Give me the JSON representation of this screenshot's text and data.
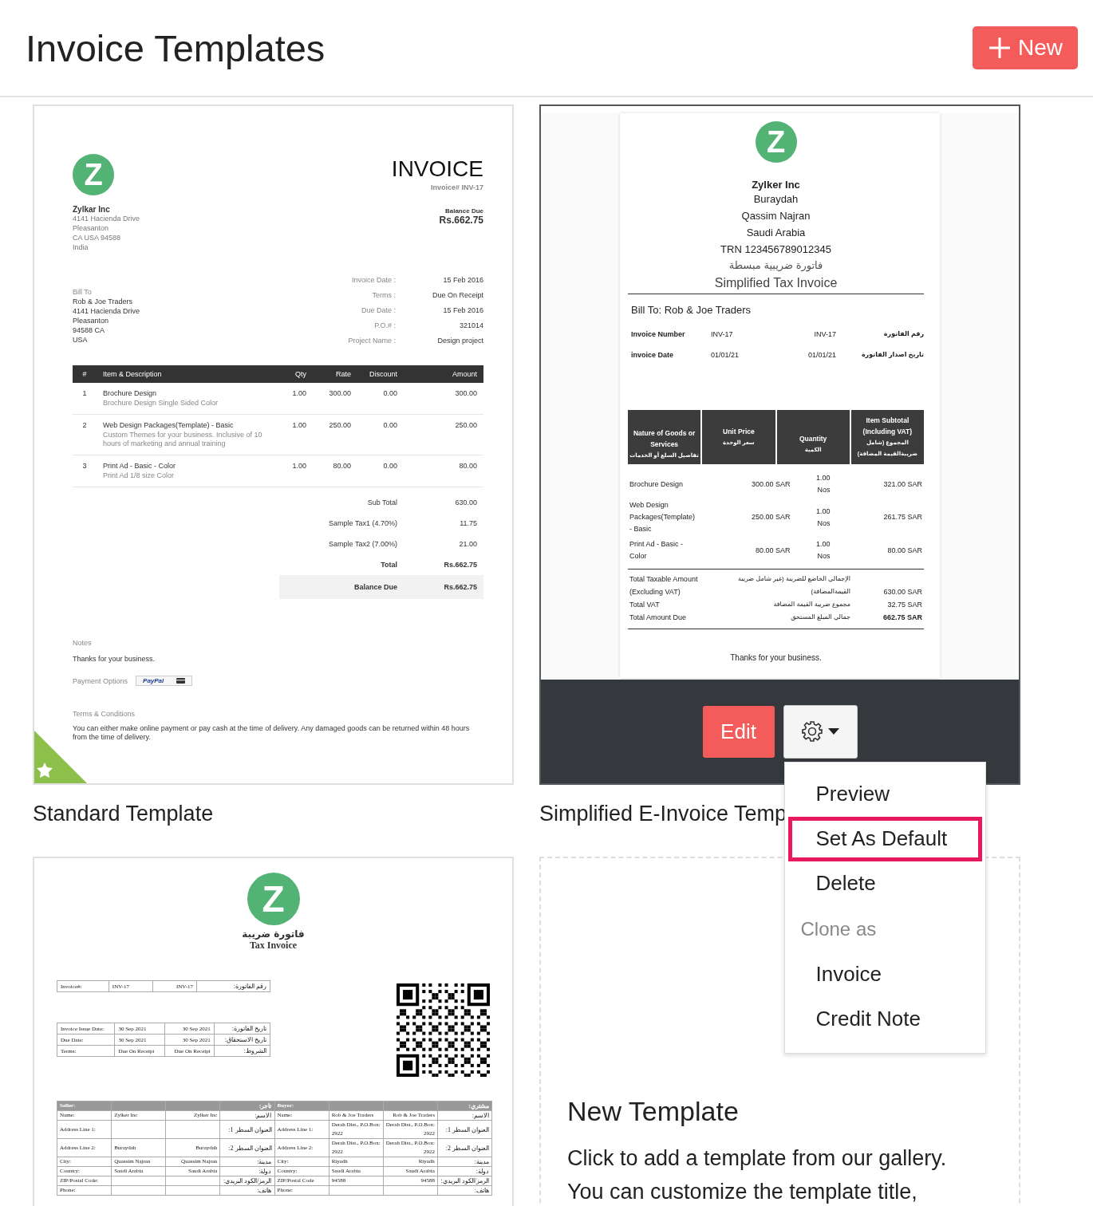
{
  "header": {
    "title": "Invoice Templates",
    "new_button": "New"
  },
  "templates": [
    {
      "kind": "standard",
      "name": "Standard Template",
      "is_default": true,
      "actions_visible": false,
      "preview": {
        "logo_letter": "Z",
        "company": "Zylkar Inc",
        "company_address": [
          "4141 Hacienda Drive",
          "Pleasanton",
          "CA USA 94588",
          "India"
        ],
        "title": "INVOICE",
        "number": "Invoice# INV-17",
        "balance_label": "Balance Due",
        "balance": "Rs.662.75",
        "bill_to_label": "Bill To",
        "bill_to": [
          "Rob & Joe Traders",
          "4141 Hacienda Drive",
          "Pleasanton",
          "94588 CA",
          "USA"
        ],
        "meta": [
          {
            "label": "Invoice Date :",
            "value": "15 Feb 2016"
          },
          {
            "label": "Terms :",
            "value": "Due On Receipt"
          },
          {
            "label": "Due Date :",
            "value": "15 Feb 2016"
          },
          {
            "label": "P.O.# :",
            "value": "321014"
          },
          {
            "label": "Project Name :",
            "value": "Design project"
          }
        ],
        "columns": [
          "#",
          "Item & Description",
          "Qty",
          "Rate",
          "Discount",
          "Amount"
        ],
        "rows": [
          {
            "number": "1",
            "item": "Brochure Design",
            "description": "Brochure Design Single Sided Color",
            "qty": "1.00",
            "rate": "300.00",
            "discount": "0.00",
            "amount": "300.00"
          },
          {
            "number": "2",
            "item": "Web Design Packages(Template) - Basic",
            "description": "Custom Themes for your business. Inclusive of 10 hours of marketing and annual training",
            "qty": "1.00",
            "rate": "250.00",
            "discount": "0.00",
            "amount": "250.00"
          },
          {
            "number": "3",
            "item": "Print Ad - Basic - Color",
            "description": "Print Ad 1/8 size Color",
            "qty": "1.00",
            "rate": "80.00",
            "discount": "0.00",
            "amount": "80.00"
          }
        ],
        "totals": [
          {
            "kind": "plain",
            "label": "Sub Total",
            "value": "630.00"
          },
          {
            "kind": "plain",
            "label": "Sample Tax1 (4.70%)",
            "value": "11.75"
          },
          {
            "kind": "plain",
            "label": "Sample Tax2 (7.00%)",
            "value": "21.00"
          },
          {
            "kind": "total",
            "label": "Total",
            "value": "Rs.662.75"
          },
          {
            "kind": "balance",
            "label": "Balance Due",
            "value": "Rs.662.75"
          }
        ],
        "notes_label": "Notes",
        "notes": "Thanks for your business.",
        "payment_label": "Payment Options",
        "payment_brand": "PayPal",
        "terms_label": "Terms & Conditions",
        "terms": "You can either make online payment or pay cash at the time of delivery. Any damaged goods can be returned within 48 hours from the time of delivery."
      }
    },
    {
      "kind": "simplified",
      "name": "Simplified E-Invoice Temp",
      "is_default": false,
      "actions_visible": true,
      "edit_button": "Edit",
      "menu": [
        {
          "kind": "item",
          "label": "Preview",
          "highlighted": false
        },
        {
          "kind": "item",
          "label": "Set As Default",
          "highlighted": true
        },
        {
          "kind": "item",
          "label": "Delete",
          "highlighted": false
        },
        {
          "kind": "heading",
          "label": "Clone as"
        },
        {
          "kind": "item",
          "label": "Invoice",
          "highlighted": false
        },
        {
          "kind": "item",
          "label": "Credit Note",
          "highlighted": false
        }
      ],
      "preview": {
        "logo_letter": "Z",
        "company": "Zylker Inc",
        "address_lines": [
          "Buraydah",
          "Qassim Najran",
          "Saudi Arabia",
          "TRN 123456789012345"
        ],
        "arabic_title": "فاتورة ضريبية مبسطة",
        "title": "Simplified Tax Invoice",
        "bill_to": "Bill To: Rob & Joe Traders",
        "info_rows": [
          [
            "Invoice Number",
            "INV-17",
            "INV-17",
            "رقم الفاتورة"
          ],
          [
            "invoice Date",
            "01/01/21",
            "01/01/21",
            "تاريخ اصدار الفاتورة"
          ]
        ],
        "columns": [
          {
            "label": "Nature of Goods or Services",
            "arabic": "تفاصيل السلع أو الخدمات"
          },
          {
            "label": "Unit Price",
            "arabic": "سعر الوحدة"
          },
          {
            "label": "Quantity",
            "arabic": "الكمية"
          },
          {
            "label": "Item Subtotal (Including VAT)",
            "arabic": "المجموع (شامل ضريبةالقيمة المضافة)"
          }
        ],
        "rows": [
          {
            "item": "Brochure Design",
            "price": "300.00 SAR",
            "qty": "1.00 Nos",
            "subtotal": "321.00 SAR"
          },
          {
            "item": "Web Design Packages(Template) - Basic",
            "price": "250.00 SAR",
            "qty": "1.00 Nos",
            "subtotal": "261.75 SAR"
          },
          {
            "item": "Print Ad - Basic - Color",
            "price": "80.00 SAR",
            "qty": "1.00 Nos",
            "subtotal": "80.00 SAR"
          }
        ],
        "totals": [
          {
            "label": "Total Taxable Amount (Excluding VAT)",
            "arabic": "الإجمالي الخاضع للضريبة (غير شامل ضريبة القيمةالمضافة)",
            "value": "630.00 SAR",
            "bold": false
          },
          {
            "label": "Total VAT",
            "arabic": "مجموع ضريبة القيمة المضافة",
            "value": "32.75 SAR",
            "bold": false
          },
          {
            "label": "Total Amount Due",
            "arabic": "جمالي المبلغ المستحق",
            "value": "662.75 SAR",
            "bold": true
          }
        ],
        "footer": "Thanks for your business."
      }
    },
    {
      "kind": "tax",
      "is_default": false,
      "actions_visible": false,
      "preview": {
        "logo_letter": "Z",
        "arabic_title": "فاتورة ضريبة",
        "title": "Tax Invoice",
        "invoice_table": [
          [
            "Invoice#:",
            "INV-17",
            "INV-17",
            "رقم الفاتورة:"
          ]
        ],
        "dates_table": [
          [
            "Invoice Issue Date:",
            "30 Sep 2021",
            "30 Sep 2021",
            "تاريخ الفاتورة:"
          ],
          [
            "Due Date:",
            "30 Sep 2021",
            "30 Sep 2021",
            "تاريخ الاستحقاق:"
          ],
          [
            "Terms:",
            "Due On Receipt",
            "Due On Receipt",
            "الشروط:"
          ]
        ],
        "parties_header": {
          "seller": {
            "label": "Seller:",
            "label_ar": "تاجر:"
          },
          "buyer": {
            "label": "Buyer:",
            "label_ar": "مشتري:"
          }
        },
        "parties_rows": [
          {
            "seller": {
              "label": "Name:",
              "value": "Zylker Inc",
              "value_ar": "Zylker Inc",
              "label_ar": "الاسم:"
            },
            "buyer": {
              "label": "Name:",
              "value": "Rob & Joe Traders",
              "value_ar": "Rob & Joe Traders",
              "label_ar": "الاسم:"
            }
          },
          {
            "seller": {
              "label": "Address Line 1:",
              "label_ar": "العنوان السطر 1:"
            },
            "buyer": {
              "label": "Address Line 1:",
              "value": "Derah Dist., P.O.Box: 2922",
              "value_ar": "Derah Dist., P.O.Box: 2922",
              "label_ar": "العنوان السطر 1:"
            }
          },
          {
            "seller": {
              "label": "Address Line 2:",
              "value": "Buraydah",
              "value_ar": "Buraydah",
              "label_ar": "العنوان السطر 2:"
            },
            "buyer": {
              "label": "Address Line 2:",
              "value": "Derah Dist., P.O.Box: 2922",
              "value_ar": "Derah Dist., P.O.Box: 2922",
              "label_ar": "العنوان السطر 2:"
            }
          },
          {
            "seller": {
              "label": "City:",
              "value": "Quassim Najran",
              "value_ar": "Quassim Najran",
              "label_ar": "مدينة:"
            },
            "buyer": {
              "label": "City:",
              "value": "Riyadh",
              "value_ar": "Riyadh",
              "label_ar": "مدينة:"
            }
          },
          {
            "seller": {
              "label": "Country:",
              "value": "Saudi Arabia",
              "value_ar": "Saudi Arabia",
              "label_ar": "دولة:"
            },
            "buyer": {
              "label": "Country:",
              "value": "Saudi Arabia",
              "value_ar": "Saudi Arabia",
              "label_ar": "دولة:"
            }
          },
          {
            "seller": {
              "label": "ZIP/Postal Code:",
              "label_ar": "الرمز/الكود البريدي:"
            },
            "buyer": {
              "label": "ZIP/Postal Code",
              "value": "94588",
              "value_ar": "94588",
              "label_ar": "الرمز/الكود البريدي:"
            }
          },
          {
            "seller": {
              "label": "Phone:",
              "label_ar": "هاتف:"
            },
            "buyer": {
              "label": "Phone:",
              "label_ar": "هاتف:"
            }
          }
        ]
      }
    },
    {
      "kind": "new",
      "title": "New Template",
      "description": "Click to add a template from our gallery. You can customize the template title,"
    }
  ]
}
